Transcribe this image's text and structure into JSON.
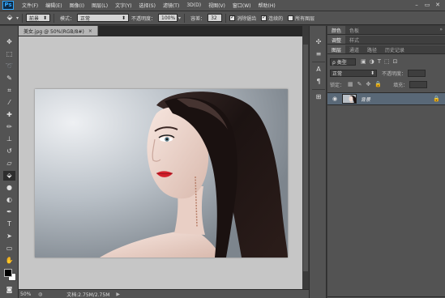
{
  "menu": {
    "logo": "Ps",
    "items": [
      "文件(F)",
      "编辑(E)",
      "图像(I)",
      "图层(L)",
      "文字(Y)",
      "选择(S)",
      "滤镜(T)",
      "3D(D)",
      "视图(V)",
      "窗口(W)",
      "帮助(H)"
    ],
    "window_controls": [
      "–",
      "▭",
      "✕"
    ]
  },
  "options": {
    "tool_glyph": "⬙",
    "fill_source": "前景",
    "mode_label": "模式：",
    "mode_value": "正常",
    "opacity_label": "不透明度：",
    "opacity_value": "100%",
    "tolerance_label": "容差：",
    "tolerance_value": "32",
    "antialias_label": "消除锯齿",
    "contiguous_label": "连续的",
    "all_layers_label": "所有图层",
    "antialias_checked": true,
    "contiguous_checked": true,
    "all_layers_checked": false
  },
  "document": {
    "tab_title": "美女.jpg @ 50%(RGB/8#)",
    "tab_close": "×"
  },
  "status": {
    "zoom": "50%",
    "doc_info": "文档:2.75M/2.75M",
    "arrow": "▶"
  },
  "panels": {
    "top_tabs": [
      "颜色",
      "色板"
    ],
    "mid_tabs": [
      "调整",
      "样式"
    ],
    "layer_tabs": [
      "图层",
      "通道",
      "路径",
      "历史记录"
    ],
    "kind_label": "ρ 类型",
    "blend_mode": "正常",
    "opacity_label": "不透明度：",
    "lock_label": "锁定：",
    "fill_label": "填充：",
    "layer": {
      "name": "背景",
      "visible_icon": "eye-icon",
      "lock_icon": "lock-icon"
    }
  },
  "colors": {
    "ui_bg": "#535353",
    "canvas_bg": "#c6c6c6",
    "layer_selected": "#596877",
    "accent": "#31a8ff"
  }
}
